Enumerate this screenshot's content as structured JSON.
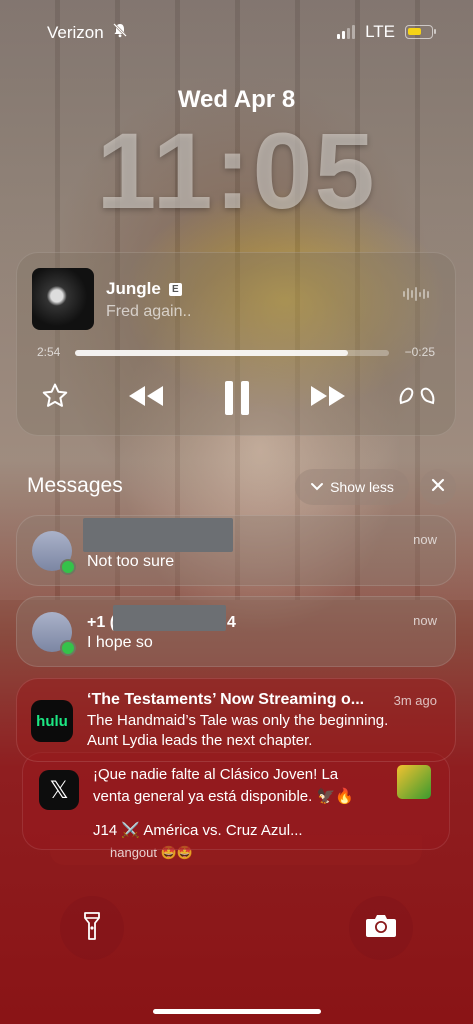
{
  "status_bar": {
    "carrier": "Verizon",
    "network": "LTE",
    "silent_icon": "bell-slash-icon",
    "signal_bars": 2,
    "battery_level": 0.45,
    "battery_color": "#f5d317"
  },
  "lockscreen": {
    "date": "Wed Apr 8",
    "time": "11:05"
  },
  "now_playing": {
    "title": "Jungle",
    "explicit_badge": "E",
    "artist": "Fred again..",
    "elapsed": "2:54",
    "remaining": "−0:25",
    "progress": 0.87,
    "controls": [
      "star-icon",
      "rewind-icon",
      "pause-icon",
      "fast-forward-icon",
      "airpods-icon"
    ]
  },
  "notifications": {
    "group_title": "Messages",
    "show_less_label": "Show less",
    "messages": [
      {
        "sender": "",
        "body": "Not too sure",
        "time": "now"
      },
      {
        "sender": "+1 (",
        "sender_suffix": "4",
        "body": "I hope so",
        "time": "now"
      }
    ],
    "hulu": {
      "app_label": "hulu",
      "title": "‘The Testaments’ Now Streaming o...",
      "time": "3m ago",
      "body_line1": "The Handmaid’s Tale was only the beginning.",
      "body_line2": "Aunt Lydia leads the next chapter."
    },
    "x_app": {
      "body_line1": "¡Que nadie falte al Clásico Joven! La",
      "body_line2": "venta general ya está disponible. 🦅🔥",
      "body_line3": "J14 ⚔️ América vs. Cruz Azul..."
    },
    "stacked_peek": "hangout 🤩🤩"
  },
  "bottom": {
    "flashlight": "flashlight-icon",
    "camera": "camera-icon"
  }
}
